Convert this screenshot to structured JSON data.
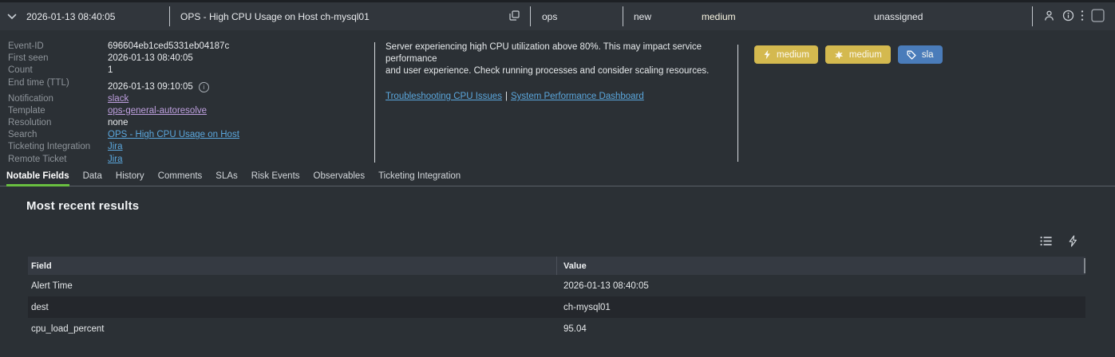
{
  "topbar": {
    "timestamp": "2026-01-13 08:40:05",
    "title": "OPS - High CPU Usage on Host ch-mysql01",
    "group": "ops",
    "status": "new",
    "urgency": "medium",
    "owner": "unassigned",
    "icons": [
      "chevron-down-icon",
      "copy-icon",
      "user-icon",
      "info-icon",
      "kebab-menu-icon",
      "checkbox"
    ]
  },
  "details": {
    "fields": [
      {
        "label": "Event-ID",
        "value": "696604eb1ced5331eb04187c",
        "style": "text"
      },
      {
        "label": "First seen",
        "value": "2026-01-13 08:40:05",
        "style": "text"
      },
      {
        "label": "Count",
        "value": "1",
        "style": "text"
      },
      {
        "label": "End time (TTL)",
        "value": "2026-01-13 09:10:05",
        "style": "text",
        "info_icon": true,
        "offset": true
      },
      {
        "label": "Notification",
        "value": "slack",
        "style": "link-purple"
      },
      {
        "label": "Template",
        "value": "ops-general-autoresolve",
        "style": "link-purple"
      },
      {
        "label": "Resolution",
        "value": "none",
        "style": "text"
      },
      {
        "label": "Search",
        "value": "OPS - High CPU Usage on Host",
        "style": "link-blue"
      },
      {
        "label": "Ticketing Integration",
        "value": "Jira",
        "style": "link-blue"
      },
      {
        "label": "Remote Ticket",
        "value": "Jira",
        "style": "link-blue"
      }
    ],
    "description": [
      "Server experiencing high CPU utilization above 80%. This may impact service performance",
      "and user experience. Check running processes and consider scaling resources."
    ],
    "doc_links": [
      "Troubleshooting CPU Issues",
      "System Performance Dashboard"
    ],
    "doc_link_separator": "|"
  },
  "badges": [
    {
      "label": "medium",
      "icon": "lightning-icon",
      "bg": "#d4b94f"
    },
    {
      "label": "medium",
      "icon": "impact-icon",
      "bg": "#d4b94f"
    },
    {
      "label": "sla",
      "icon": "tag-icon",
      "bg": "#4a7cba"
    }
  ],
  "tabs": {
    "items": [
      "Notable Fields",
      "Data",
      "History",
      "Comments",
      "SLAs",
      "Risk Events",
      "Observables",
      "Ticketing Integration"
    ],
    "active": "Notable Fields"
  },
  "results": {
    "heading": "Most recent results",
    "action_icons": [
      "list-icon",
      "lightning-bolt-icon"
    ],
    "table": {
      "columns": [
        "Field",
        "Value"
      ],
      "rows": [
        {
          "field": "Alert Time",
          "value": "2026-01-13 08:40:05"
        },
        {
          "field": "dest",
          "value": "ch-mysql01"
        },
        {
          "field": "cpu_load_percent",
          "value": "95.04"
        }
      ]
    }
  },
  "colors": {
    "urgency_badge": "#d4b94f",
    "sla_badge": "#4a7cba",
    "active_tab_underline": "#69bf40",
    "link_blue": "#5ba7dd",
    "link_purple": "#bfa0e0",
    "topbar_bg": "#31363c",
    "page_bg": "#2b3035",
    "table_header_bg": "#353a42",
    "striped_row_bg": "#24272c"
  }
}
